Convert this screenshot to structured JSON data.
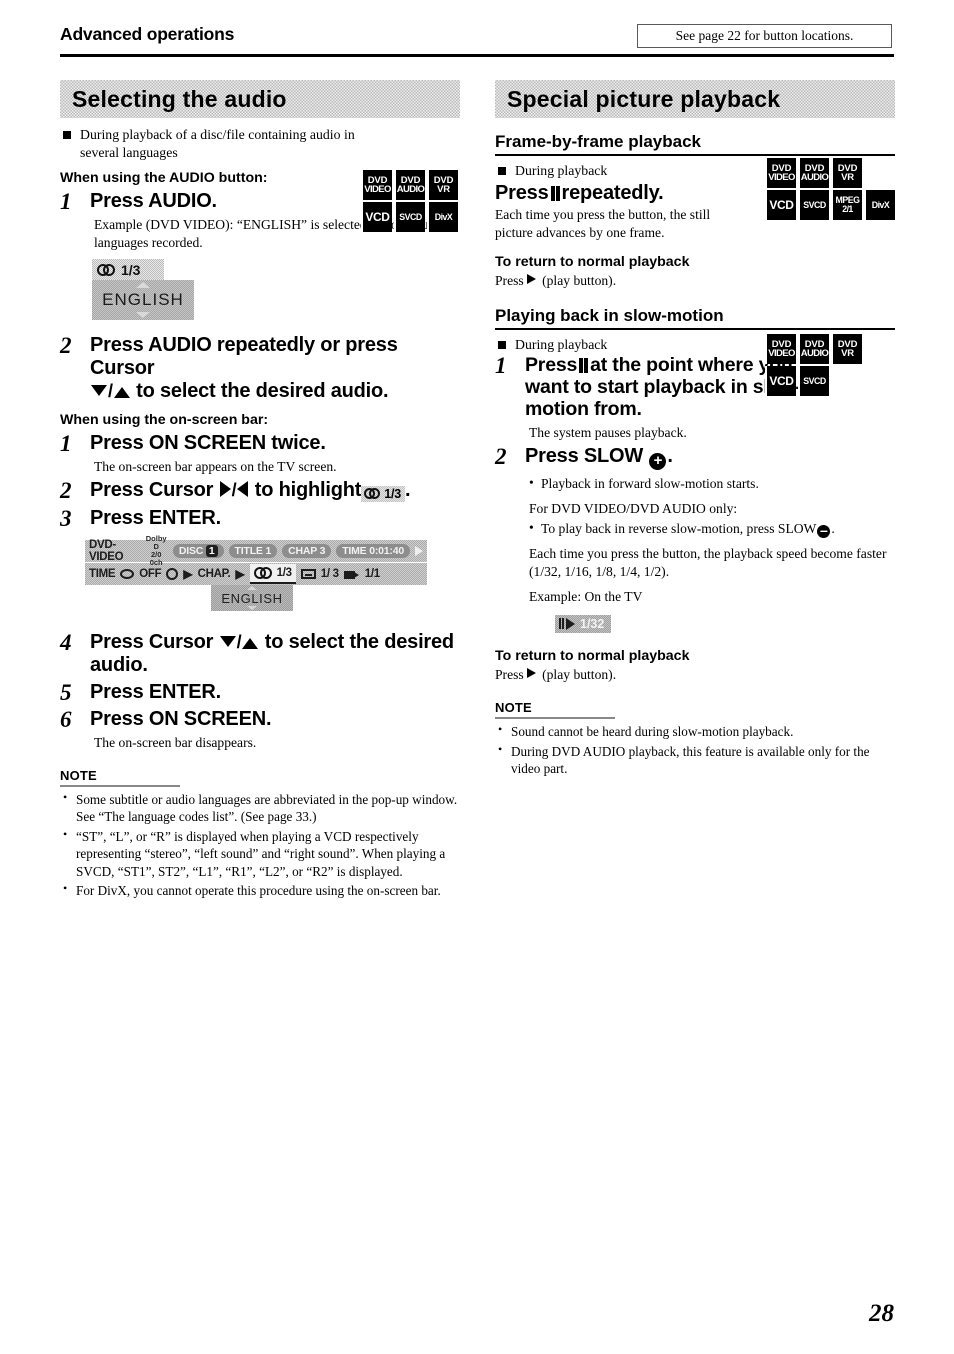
{
  "header": {
    "running_head": "Advanced operations",
    "button_locations_note": "See page 22 for button locations."
  },
  "page_number": "28",
  "left_column": {
    "banner_title": "Selecting the audio",
    "intro_bullet": "During playback of a disc/file containing audio in several languages",
    "intro_badges": {
      "row1": [
        "DVD|VIDEO",
        "DVD|AUDIO",
        "DVD|VR"
      ],
      "row2": [
        "VCD",
        "SVCD",
        "DivX"
      ]
    },
    "method1_label": "When using the AUDIO button:",
    "method1_steps": [
      {
        "num": "1",
        "title": "Press AUDIO.",
        "desc": "Example (DVD VIDEO): “ENGLISH” is selected out of 3 audio languages recorded."
      },
      {
        "num": "2",
        "title_part1": "Press AUDIO repeatedly or press Cursor",
        "title_part2": "to select the desired audio."
      }
    ],
    "audio_example": {
      "counter": "1/3",
      "language": "ENGLISH"
    },
    "method2_label": "When using the on-screen bar:",
    "method2_steps": [
      {
        "num": "1",
        "title": "Press ON SCREEN twice.",
        "desc": "The on-screen bar appears on the TV screen."
      },
      {
        "num": "2",
        "title_prefix": "Press Cursor",
        "title_mid": "/",
        "title_suffix": "to highlight",
        "chip": "1/3",
        "title_end": "."
      },
      {
        "num": "3",
        "title": "Press ENTER."
      },
      {
        "num": "4",
        "title_part1": "Press Cursor",
        "title_part2": "to select the desired audio."
      },
      {
        "num": "5",
        "title": "Press ENTER."
      },
      {
        "num": "6",
        "title": "Press ON SCREEN.",
        "desc": "The on-screen bar disappears."
      }
    ],
    "onscreen_bar": {
      "disc_format": "DVD-VIDEO",
      "dolby_line1": "Dolby D",
      "dolby_line2": "2/0  0ch",
      "disc": "DISC 1",
      "disc_label": "DISC",
      "disc_value": "1",
      "title_label": "TITLE",
      "title_value": "1",
      "chap_label": "CHAP",
      "chap_value": "3",
      "time_label": "TIME",
      "time_value": "0:01:40",
      "row2_time": "TIME",
      "row2_repeat": "OFF",
      "row2_chapter": "CHAP.",
      "audio_value": "1/3",
      "subtitle_value": "1/ 3",
      "angle_value": "1/1",
      "language": "ENGLISH"
    },
    "note_label": "NOTE",
    "notes": [
      "Some subtitle or audio languages are abbreviated in the pop-up window. See “The language codes list”. (See page 33.)",
      "“ST”, “L”, or “R” is displayed when playing a VCD respectively representing “stereo”, “left sound” and “right sound”. When playing a SVCD, “ST1”, ST2”, “L1”, “R1”, “L2”, or “R2” is displayed.",
      "For DivX, you cannot operate this procedure using the on-screen bar."
    ]
  },
  "right_column": {
    "banner_title": "Special picture playback",
    "section1": {
      "heading": "Frame-by-frame playback",
      "bullet": "During playback",
      "command_prefix": "Press",
      "command_suffix": "repeatedly.",
      "desc": "Each time you press the button, the still picture advances by one frame.",
      "return_label": "To return to normal playback",
      "return_text_prefix": "Press",
      "return_text_suffix": "(play button).",
      "badges": {
        "row1": [
          "DVD|VIDEO",
          "DVD|AUDIO",
          "DVD|VR"
        ],
        "row2": [
          "VCD",
          "SVCD",
          "MPEG|2/1",
          "DivX"
        ]
      }
    },
    "section2": {
      "heading": "Playing back in slow-motion",
      "bullet": "During playback",
      "badges": {
        "row1": [
          "DVD|VIDEO",
          "DVD|AUDIO",
          "DVD|VR"
        ],
        "row2": [
          "VCD",
          "SVCD"
        ]
      },
      "step1": {
        "num": "1",
        "title_line1": "Press",
        "title_line1b": "at the point where",
        "title_line2": "you want to start playback",
        "title_line3": "in slow-motion from.",
        "desc": "The system pauses playback."
      },
      "step2": {
        "num": "2",
        "title_prefix": "Press SLOW",
        "title_suffix": ".",
        "bullet1": "Playback in forward slow-motion starts.",
        "note_only": "For DVD VIDEO/DVD AUDIO only:",
        "bullet2_prefix": "To play back in reverse slow-motion, press SLOW",
        "bullet2_suffix": ".",
        "para1": "Each time you press the button, the playback speed become faster (1/32, 1/16, 1/8, 1/4, 1/2).",
        "para2": "Example: On the TV",
        "speed_chip": "1/32"
      },
      "return_label": "To return to normal playback",
      "return_text_prefix": "Press",
      "return_text_suffix": "(play button).",
      "note_label": "NOTE",
      "notes": [
        "Sound cannot be heard during slow-motion playback.",
        "During DVD AUDIO playback, this feature is available only for the video part."
      ]
    }
  }
}
